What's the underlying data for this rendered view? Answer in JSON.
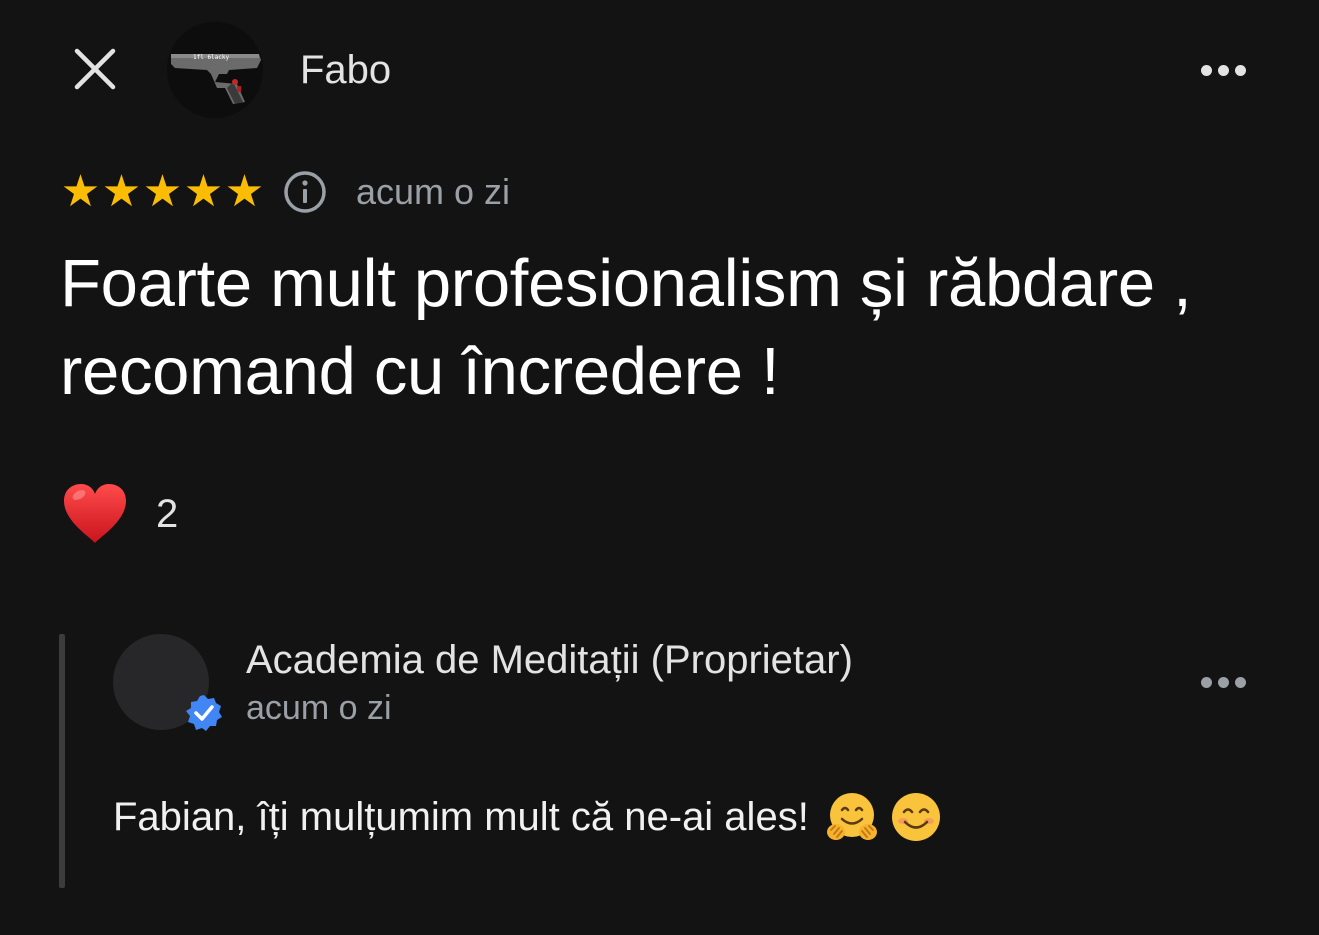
{
  "header": {
    "close_icon": "close-icon",
    "author_name": "Fabo",
    "avatar_text": "1fl 6lacky",
    "more_icon": "more-horizontal-icon"
  },
  "review": {
    "rating": 5,
    "max_rating": 5,
    "star_color": "#fbbc04",
    "info_icon": "info-icon",
    "time": "acum o zi",
    "text": "Foarte mult profesionalism și răbdare , recomand cu încredere !"
  },
  "reaction": {
    "icon": "heart-icon",
    "count": "2"
  },
  "owner_reply": {
    "name": "Academia de Meditații (Proprietar)",
    "time": "acum o zi",
    "verified_color": "#4285f4",
    "text": "Fabian, îți mulțumim mult că ne-ai ales!",
    "emojis": [
      "hugging-face-icon",
      "smiling-face-icon"
    ]
  }
}
